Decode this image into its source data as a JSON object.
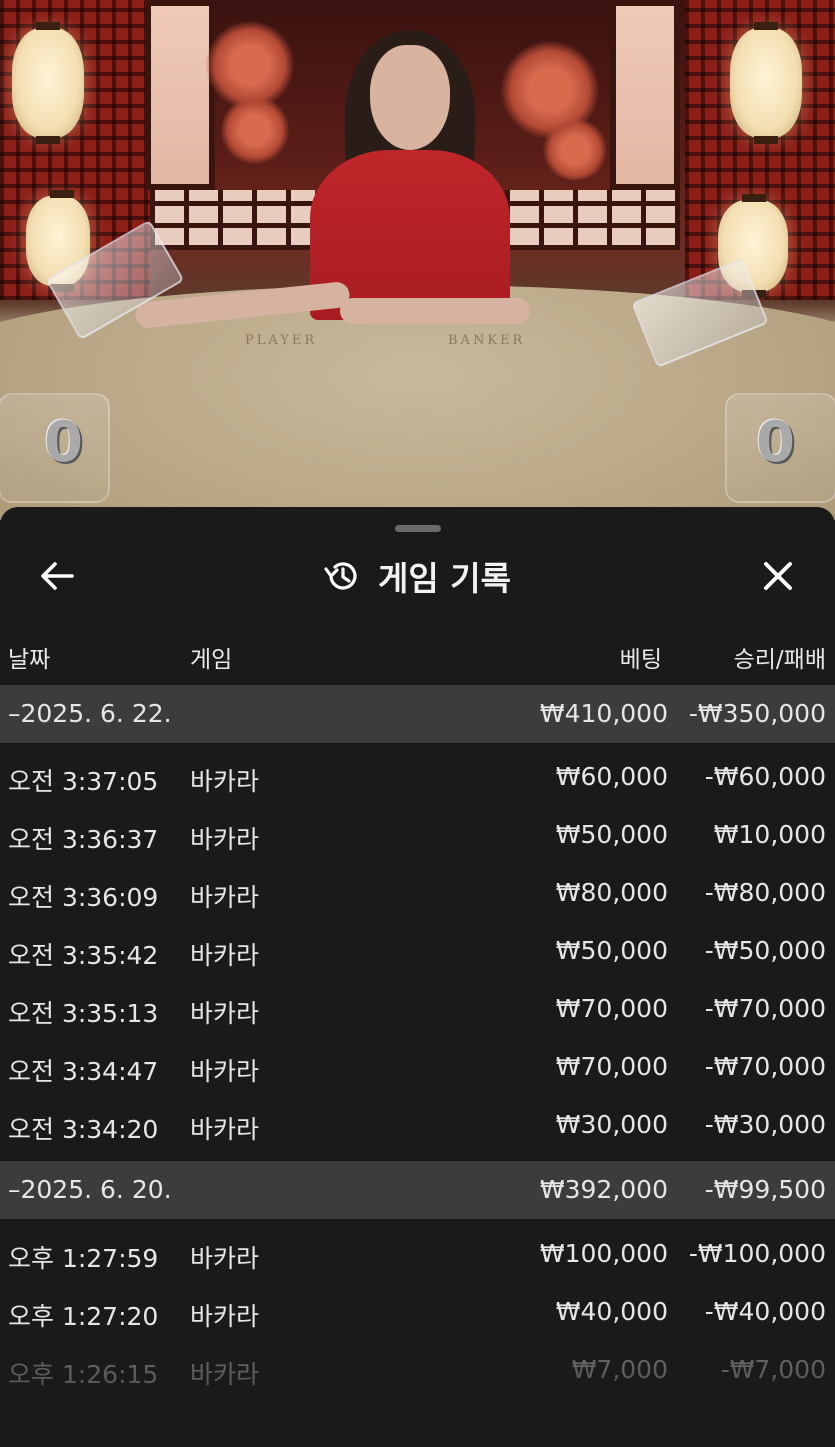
{
  "video": {
    "player_label": "PLAYER",
    "banker_label": "BANKER",
    "player_score": "0",
    "banker_score": "0"
  },
  "sheet": {
    "title": "게임 기록",
    "title_icon": "history-icon",
    "back_icon": "arrow-left-icon",
    "close_icon": "close-icon"
  },
  "columns": {
    "date": "날짜",
    "game": "게임",
    "bet": "베팅",
    "result": "승리/패배"
  },
  "groups": [
    {
      "date": "–2025. 6. 22.",
      "bet_total": "₩410,000",
      "result_total": "-₩350,000",
      "rows": [
        {
          "time": "오전 3:37:05",
          "game": "바카라",
          "bet": "₩60,000",
          "result": "-₩60,000"
        },
        {
          "time": "오전 3:36:37",
          "game": "바카라",
          "bet": "₩50,000",
          "result": "₩10,000"
        },
        {
          "time": "오전 3:36:09",
          "game": "바카라",
          "bet": "₩80,000",
          "result": "-₩80,000"
        },
        {
          "time": "오전 3:35:42",
          "game": "바카라",
          "bet": "₩50,000",
          "result": "-₩50,000"
        },
        {
          "time": "오전 3:35:13",
          "game": "바카라",
          "bet": "₩70,000",
          "result": "-₩70,000"
        },
        {
          "time": "오전 3:34:47",
          "game": "바카라",
          "bet": "₩70,000",
          "result": "-₩70,000"
        },
        {
          "time": "오전 3:34:20",
          "game": "바카라",
          "bet": "₩30,000",
          "result": "-₩30,000"
        }
      ]
    },
    {
      "date": "–2025. 6. 20.",
      "bet_total": "₩392,000",
      "result_total": "-₩99,500",
      "rows": [
        {
          "time": "오후 1:27:59",
          "game": "바카라",
          "bet": "₩100,000",
          "result": "-₩100,000"
        },
        {
          "time": "오후 1:27:20",
          "game": "바카라",
          "bet": "₩40,000",
          "result": "-₩40,000"
        },
        {
          "time": "오후 1:26:15",
          "game": "바카라",
          "bet": "₩7,000",
          "result": "-₩7,000"
        }
      ]
    }
  ]
}
